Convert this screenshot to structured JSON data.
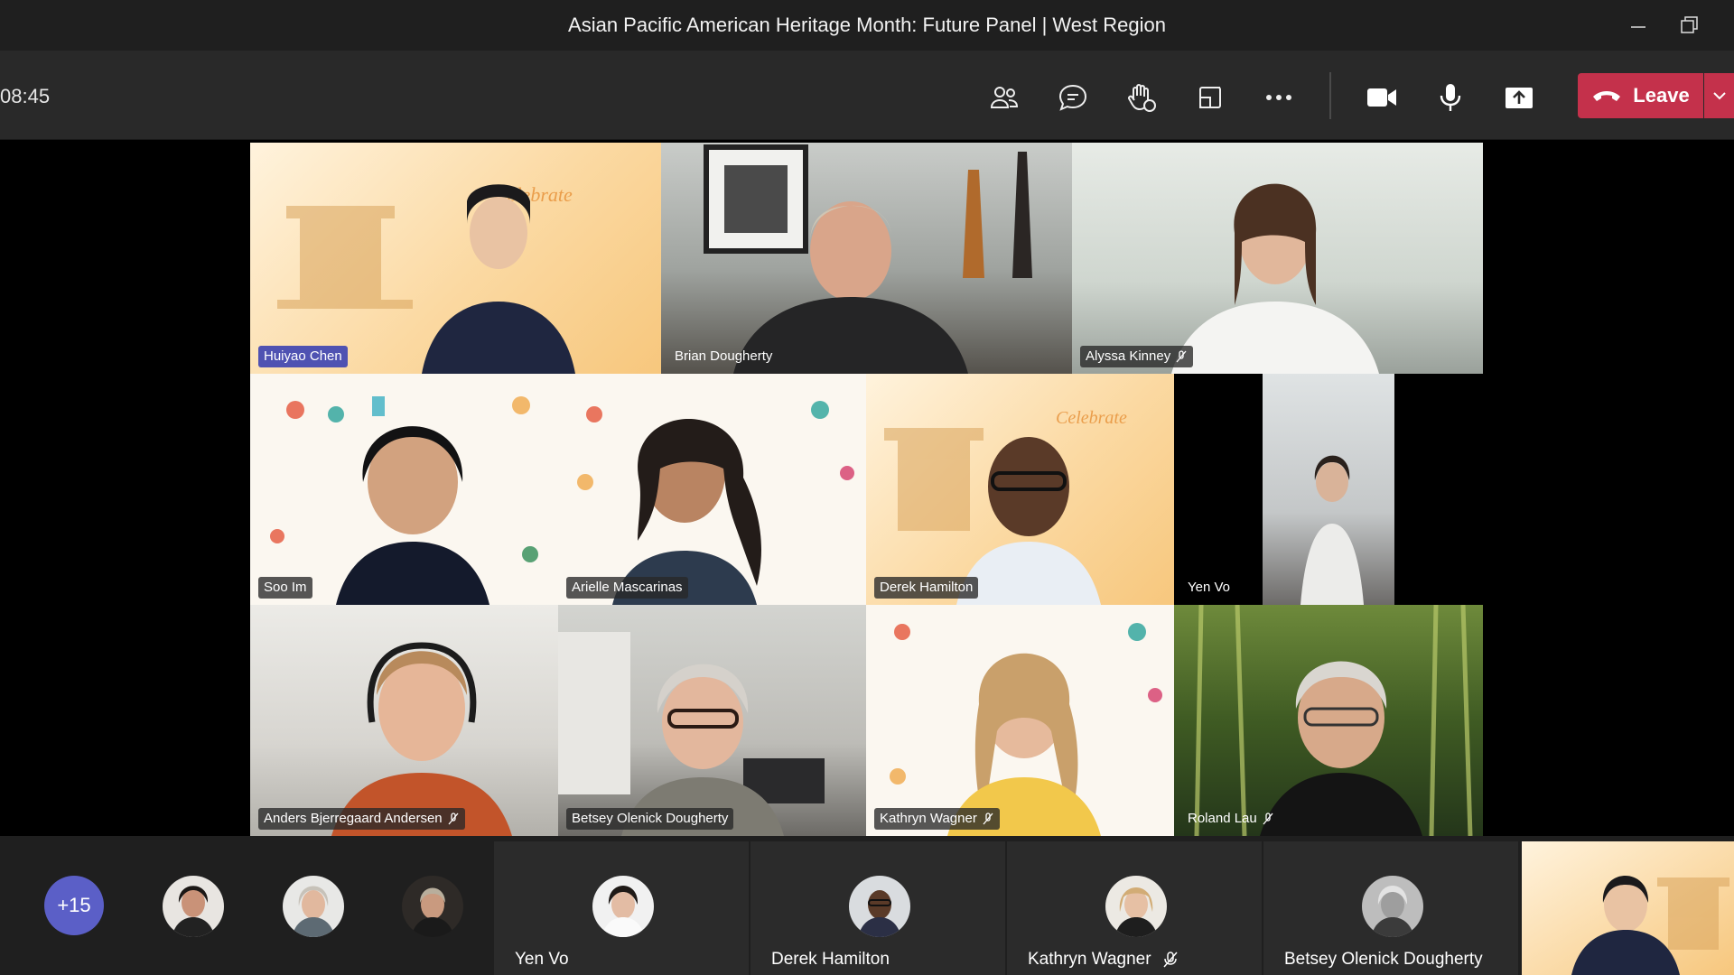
{
  "window": {
    "title": "Asian Pacific American Heritage Month: Future Panel | West Region"
  },
  "toolbar": {
    "timer": "08:45",
    "buttons": [
      {
        "id": "participants",
        "icon": "participants-icon"
      },
      {
        "id": "chat",
        "icon": "chat-icon"
      },
      {
        "id": "reactions",
        "icon": "raise-hand-icon"
      },
      {
        "id": "rooms",
        "icon": "rooms-icon"
      },
      {
        "id": "more",
        "icon": "more-icon"
      },
      {
        "id": "camera",
        "icon": "camera-icon"
      },
      {
        "id": "mic",
        "icon": "mic-icon"
      },
      {
        "id": "share",
        "icon": "share-icon"
      }
    ],
    "leave_label": "Leave",
    "leave_color": "#c4314b"
  },
  "grid": {
    "tiles": [
      {
        "name": "Huiyao Chen",
        "muted": false,
        "highlighted": true
      },
      {
        "name": "Brian Dougherty",
        "muted": false
      },
      {
        "name": "Alyssa Kinney",
        "muted": true
      },
      {
        "name": "Soo Im",
        "muted": false
      },
      {
        "name": "Arielle Mascarinas",
        "muted": false
      },
      {
        "name": "Derek Hamilton",
        "muted": false
      },
      {
        "name": "Yen Vo",
        "muted": false
      },
      {
        "name": "Anders Bjerregaard Andersen",
        "muted": true
      },
      {
        "name": "Betsey Olenick Dougherty",
        "muted": false
      },
      {
        "name": "Kathryn Wagner",
        "muted": true
      },
      {
        "name": "Roland Lau",
        "muted": true
      }
    ]
  },
  "strip": {
    "overflow_count": "+15",
    "tiles": [
      {
        "name": "Yen Vo",
        "muted": false
      },
      {
        "name": "Derek Hamilton",
        "muted": false
      },
      {
        "name": "Kathryn Wagner",
        "muted": true
      },
      {
        "name": "Betsey Olenick Dougherty",
        "muted": false
      }
    ]
  },
  "colors": {
    "accent": "#5b5fc7",
    "highlight_tag": "#4f52b2",
    "leave": "#c4314b"
  }
}
